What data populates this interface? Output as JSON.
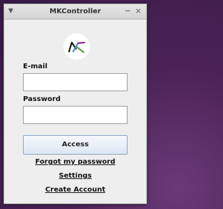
{
  "window": {
    "title": "MKController",
    "menu_icon": "triangle-down-icon",
    "minimize_glyph": "−",
    "close_glyph": "×"
  },
  "logo": {
    "name": "mk-logo",
    "colors": [
      "#1a1a1a",
      "#3a8ccf",
      "#5a9e3a",
      "#8a2a8a"
    ]
  },
  "form": {
    "email_label": "E-mail",
    "email_value": "",
    "email_placeholder": "",
    "password_label": "Password",
    "password_value": "",
    "password_placeholder": ""
  },
  "actions": {
    "access_label": "Access",
    "forgot_label": "Forgot my password",
    "settings_label": "Settings",
    "create_label": "Create Account"
  }
}
